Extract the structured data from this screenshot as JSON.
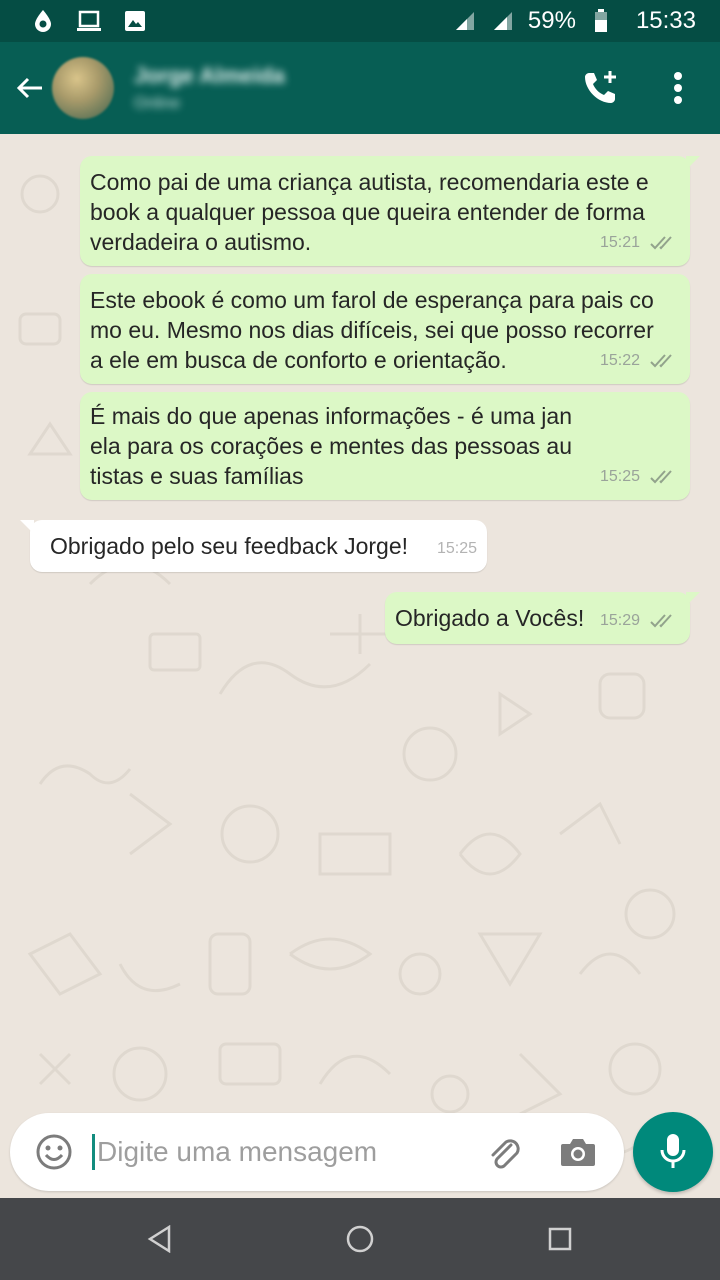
{
  "status_bar": {
    "battery": "59%",
    "time": "15:33"
  },
  "header": {
    "contact_name": "Jorge Almeida",
    "contact_status": "Online",
    "back_icon": "arrow-left-icon",
    "call_icon": "add-call-icon",
    "menu_icon": "more-vert-icon"
  },
  "messages": [
    {
      "direction": "out",
      "text": "Como pai de uma criança autista, recomendaria este e\nbook a qualquer pessoa que queira entender de forma\nverdadeira o autismo.",
      "time": "15:21",
      "status": "double-check"
    },
    {
      "direction": "out",
      "text": "Este ebook é como um farol de esperança para pais co\nmo eu. Mesmo nos dias difíceis, sei que posso recorrer\na ele em busca de conforto e orientação.",
      "time": "15:22",
      "status": "double-check"
    },
    {
      "direction": "out",
      "text": "É mais do que apenas informações - é uma jan\nela para os corações e mentes das pessoas au\ntistas e suas famílias",
      "time": "15:25",
      "status": "double-check"
    },
    {
      "direction": "in",
      "text": "Obrigado pelo seu feedback Jorge!",
      "time": "15:25"
    },
    {
      "direction": "out",
      "text": "Obrigado a Vocês!",
      "time": "15:29",
      "status": "double-check"
    }
  ],
  "composer": {
    "placeholder": "Digite uma mensagem",
    "emoji_icon": "emoji-icon",
    "attach_icon": "paperclip-icon",
    "camera_icon": "camera-icon",
    "mic_icon": "mic-icon"
  },
  "colors": {
    "header": "#075e54",
    "status_bar": "#054d44",
    "outgoing_bubble": "#dcf8c6",
    "incoming_bubble": "#ffffff",
    "chat_bg": "#ece5dd",
    "accent": "#00897b"
  }
}
